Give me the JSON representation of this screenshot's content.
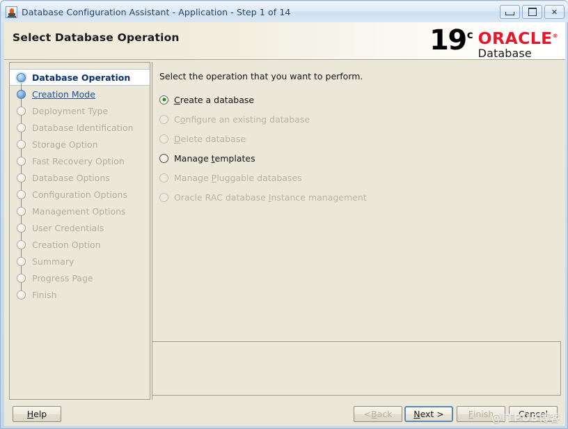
{
  "window": {
    "title": "Database Configuration Assistant - Application - Step 1 of 14",
    "app_icon": "java-cup-icon",
    "controls": {
      "minimize": "minimize-icon",
      "maximize": "maximize-icon",
      "close": "✕"
    }
  },
  "header": {
    "page_title": "Select Database Operation",
    "logo": {
      "version": "19",
      "version_suffix": "c",
      "brand": "ORACLE",
      "registered": "®",
      "product": "Database",
      "brand_color": "#e8162b"
    }
  },
  "sidebar": {
    "steps": [
      {
        "label": "Database Operation",
        "state": "current"
      },
      {
        "label": "Creation Mode",
        "state": "link"
      },
      {
        "label": "Deployment Type",
        "state": "todo"
      },
      {
        "label": "Database Identification",
        "state": "todo"
      },
      {
        "label": "Storage Option",
        "state": "todo"
      },
      {
        "label": "Fast Recovery Option",
        "state": "todo"
      },
      {
        "label": "Database Options",
        "state": "todo"
      },
      {
        "label": "Configuration Options",
        "state": "todo"
      },
      {
        "label": "Management Options",
        "state": "todo"
      },
      {
        "label": "User Credentials",
        "state": "todo"
      },
      {
        "label": "Creation Option",
        "state": "todo"
      },
      {
        "label": "Summary",
        "state": "todo"
      },
      {
        "label": "Progress Page",
        "state": "todo"
      },
      {
        "label": "Finish",
        "state": "todo"
      }
    ]
  },
  "content": {
    "instruction": "Select the operation that you want to perform.",
    "options": [
      {
        "label": "Create a database",
        "mnemonic": "C",
        "selected": true,
        "enabled": true
      },
      {
        "label": "Configure an existing database",
        "mnemonic": "o",
        "selected": false,
        "enabled": false
      },
      {
        "label": "Delete database",
        "mnemonic": "D",
        "selected": false,
        "enabled": false
      },
      {
        "label": "Manage templates",
        "mnemonic": "t",
        "selected": false,
        "enabled": true
      },
      {
        "label": "Manage Pluggable databases",
        "mnemonic": "P",
        "selected": false,
        "enabled": false
      },
      {
        "label": "Oracle RAC database Instance management",
        "mnemonic": "I",
        "selected": false,
        "enabled": false
      }
    ],
    "message_panel_text": ""
  },
  "buttons": {
    "help": {
      "label": "Help",
      "mnemonic": "H",
      "enabled": true,
      "focused": false
    },
    "back": {
      "label": "< Back",
      "mnemonic": "B",
      "enabled": false,
      "focused": false
    },
    "next": {
      "label": "Next >",
      "mnemonic": "N",
      "enabled": true,
      "focused": true
    },
    "finish": {
      "label": "Finish",
      "mnemonic": "F",
      "enabled": false,
      "focused": false
    },
    "cancel": {
      "label": "Cancel",
      "mnemonic": "",
      "enabled": true,
      "focused": false
    }
  },
  "watermark": "@ITPUB博客"
}
